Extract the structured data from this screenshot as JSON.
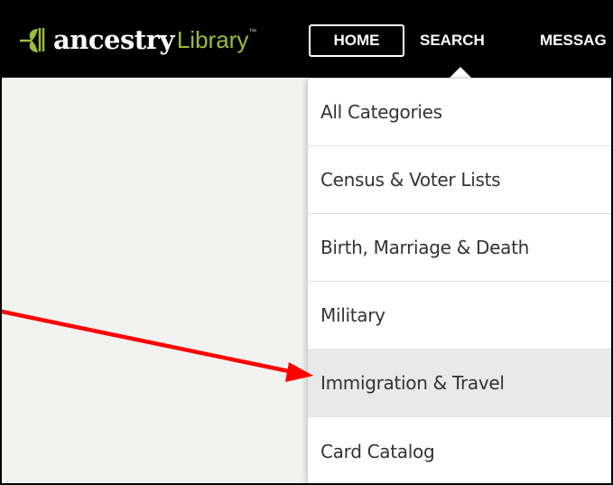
{
  "header": {
    "logo_word": "ancestry",
    "logo_library": "Library",
    "logo_tm": "™",
    "nav": {
      "home": "HOME",
      "search": "SEARCH",
      "messages": "MESSAG"
    }
  },
  "search_menu": {
    "items": [
      {
        "label": "All Categories"
      },
      {
        "label": "Census & Voter Lists"
      },
      {
        "label": "Birth, Marriage & Death"
      },
      {
        "label": "Military"
      },
      {
        "label": "Immigration & Travel",
        "highlighted": true
      },
      {
        "label": "Card Catalog"
      }
    ]
  },
  "annotation": {
    "arrow_color": "#ff0000",
    "points_to": "Immigration & Travel"
  },
  "colors": {
    "header_bg": "#000000",
    "brand_green": "#9cbc3c",
    "highlight_bg": "#e9e9e9"
  }
}
